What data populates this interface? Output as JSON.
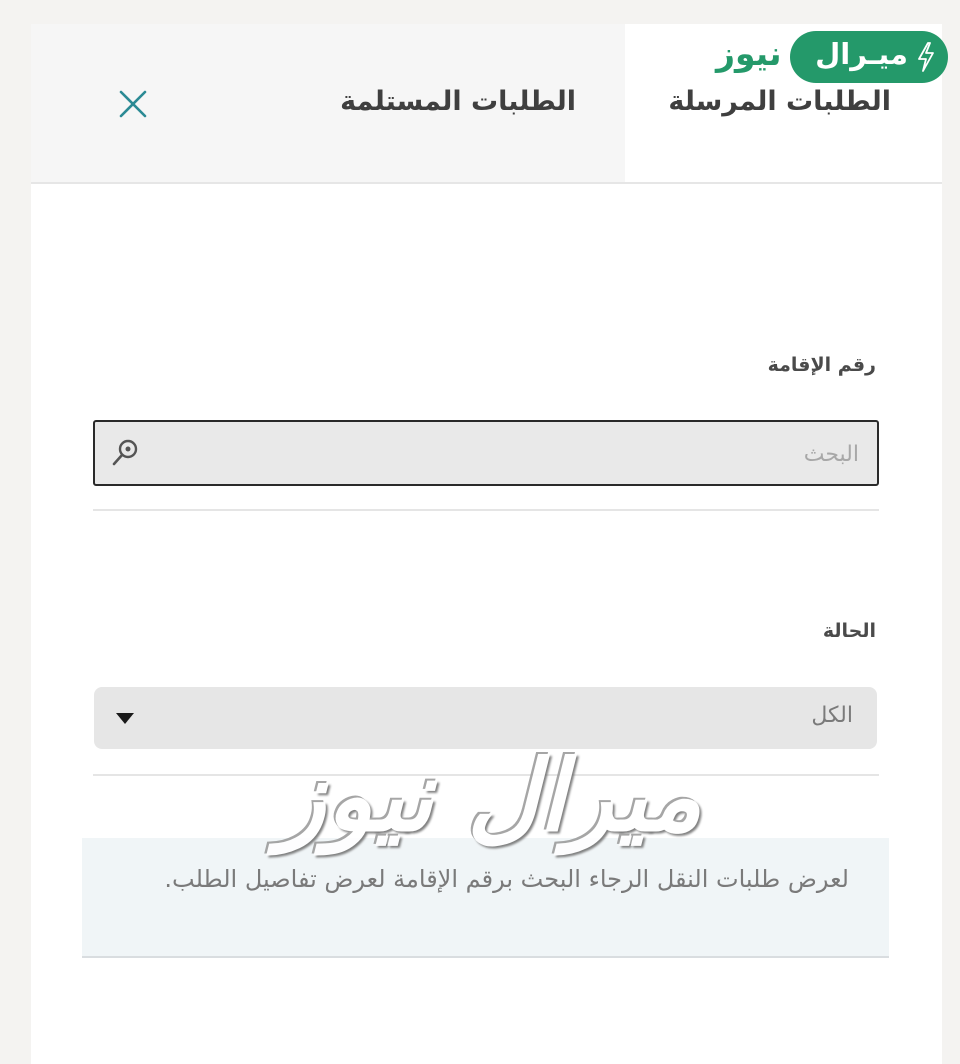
{
  "tabs": {
    "sent_label": "الطلبات المرسلة",
    "received_label": "الطلبات المستلمة",
    "close_icon": "close-icon"
  },
  "brand": {
    "pill_text": "ميـرال",
    "word_text": "نيوز",
    "icon": "bolt-icon",
    "color": "#24996a"
  },
  "form": {
    "iqama_label": "رقم الإقامة",
    "search_placeholder": "البحث",
    "search_value": "",
    "search_icon": "search-icon",
    "status_label": "الحالة",
    "status_selected": "الكل",
    "status_icon": "chevron-down-icon"
  },
  "info": {
    "message": "لعرض طلبات النقل الرجاء البحث برقم الإقامة لعرض تفاصيل الطلب."
  },
  "watermark": {
    "text": "ميرال نيوز"
  }
}
